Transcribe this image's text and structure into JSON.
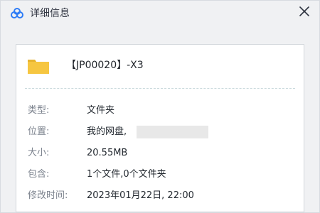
{
  "window": {
    "title": "详细信息",
    "close_label": "×"
  },
  "file": {
    "name": "【JP00020】-X3"
  },
  "details": [
    {
      "label": "类型:",
      "value": "文件夹"
    },
    {
      "label": "位置:",
      "value": "我的网盘,"
    },
    {
      "label": "大小:",
      "value": "20.55MB"
    },
    {
      "label": "包含:",
      "value": "1个文件,0个文件夹"
    },
    {
      "label": "修改时间:",
      "value": "2023年01月22日, 22:00"
    }
  ],
  "colors": {
    "logo_blue": "#2f7df6",
    "folder_yellow": "#f6c641",
    "folder_tab": "#e7b42f"
  },
  "icons": {
    "logo": "app-logo-icon",
    "close": "close-icon",
    "folder": "folder-icon"
  }
}
